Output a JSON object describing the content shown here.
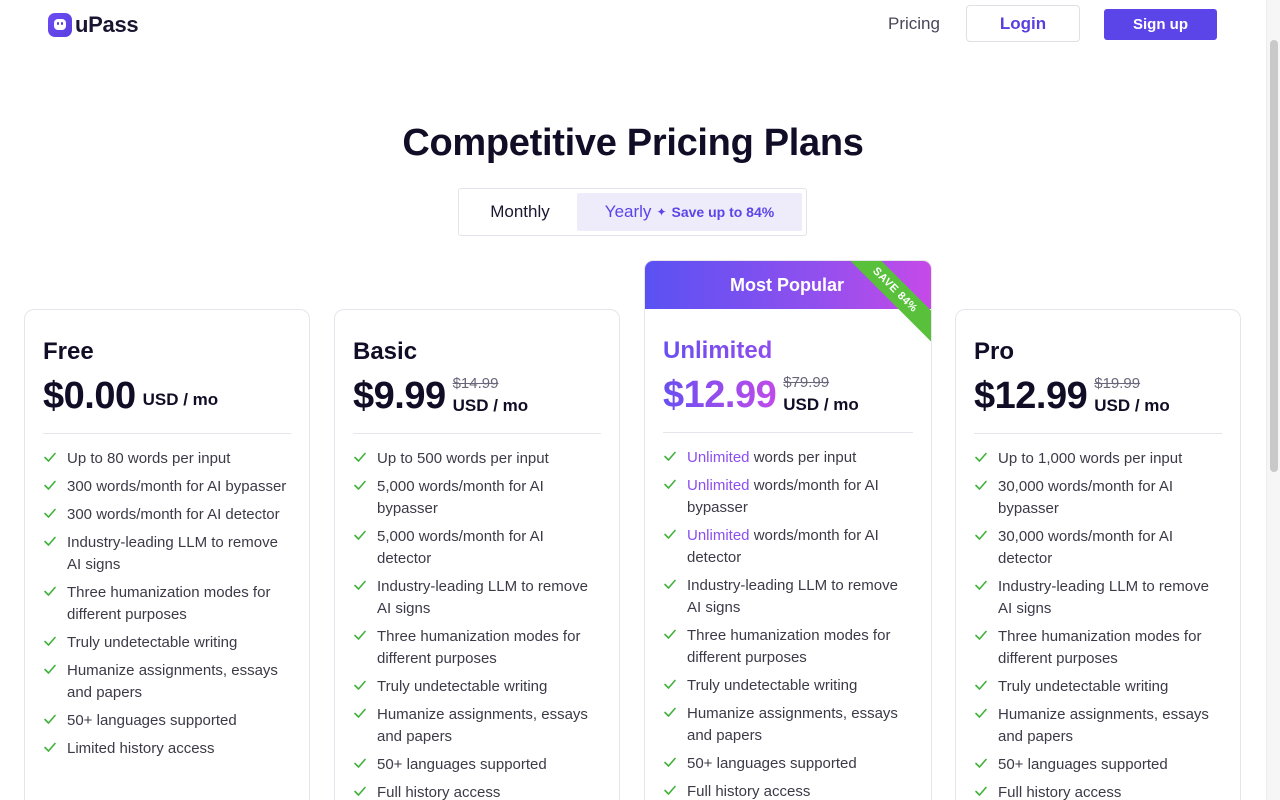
{
  "brand": {
    "name": "uPass"
  },
  "nav": {
    "pricing": "Pricing",
    "login": "Login",
    "signup": "Sign up"
  },
  "page": {
    "title": "Competitive Pricing Plans"
  },
  "billing_toggle": {
    "monthly": "Monthly",
    "yearly": "Yearly",
    "save_badge": "Save up to 84%",
    "selected": "Yearly"
  },
  "colors": {
    "accent": "#5b45e8",
    "check": "#40b23b",
    "ribbon": "#58c03b"
  },
  "plans": [
    {
      "name": "Free",
      "price": "$0.00",
      "old_price": "",
      "unit": "USD / mo",
      "features": [
        {
          "text": "Up to 80 words per input"
        },
        {
          "text": "300 words/month for AI bypasser"
        },
        {
          "text": "300 words/month for AI detector"
        },
        {
          "text": "Industry-leading LLM to remove AI signs"
        },
        {
          "text": "Three humanization modes for different purposes"
        },
        {
          "text": "Truly undetectable writing"
        },
        {
          "text": "Humanize assignments, essays and papers"
        },
        {
          "text": "50+ languages supported"
        },
        {
          "text": "Limited history access"
        }
      ]
    },
    {
      "name": "Basic",
      "price": "$9.99",
      "old_price": "$14.99",
      "unit": "USD / mo",
      "features": [
        {
          "text": "Up to 500 words per input"
        },
        {
          "text": "5,000 words/month for AI bypasser"
        },
        {
          "text": "5,000 words/month for AI detector"
        },
        {
          "text": "Industry-leading LLM to remove AI signs"
        },
        {
          "text": "Three humanization modes for different purposes"
        },
        {
          "text": "Truly undetectable writing"
        },
        {
          "text": "Humanize assignments, essays and papers"
        },
        {
          "text": "50+ languages supported"
        },
        {
          "text": "Full history access"
        }
      ]
    },
    {
      "name": "Unlimited",
      "price": "$12.99",
      "old_price": "$79.99",
      "unit": "USD / mo",
      "banner": "Most Popular",
      "ribbon": "SAVE 84%",
      "features": [
        {
          "highlight": "Unlimited",
          "text": " words per input"
        },
        {
          "highlight": "Unlimited",
          "text": " words/month for AI bypasser"
        },
        {
          "highlight": "Unlimited",
          "text": " words/month for AI detector"
        },
        {
          "text": "Industry-leading LLM to remove AI signs"
        },
        {
          "text": "Three humanization modes for different purposes"
        },
        {
          "text": "Truly undetectable writing"
        },
        {
          "text": "Humanize assignments, essays and papers"
        },
        {
          "text": "50+ languages supported"
        },
        {
          "text": "Full history access"
        }
      ]
    },
    {
      "name": "Pro",
      "price": "$12.99",
      "old_price": "$19.99",
      "unit": "USD / mo",
      "features": [
        {
          "text": "Up to 1,000 words per input"
        },
        {
          "text": "30,000 words/month for AI bypasser"
        },
        {
          "text": "30,000 words/month for AI detector"
        },
        {
          "text": "Industry-leading LLM to remove AI signs"
        },
        {
          "text": "Three humanization modes for different purposes"
        },
        {
          "text": "Truly undetectable writing"
        },
        {
          "text": "Humanize assignments, essays and papers"
        },
        {
          "text": "50+ languages supported"
        },
        {
          "text": "Full history access"
        }
      ]
    }
  ]
}
